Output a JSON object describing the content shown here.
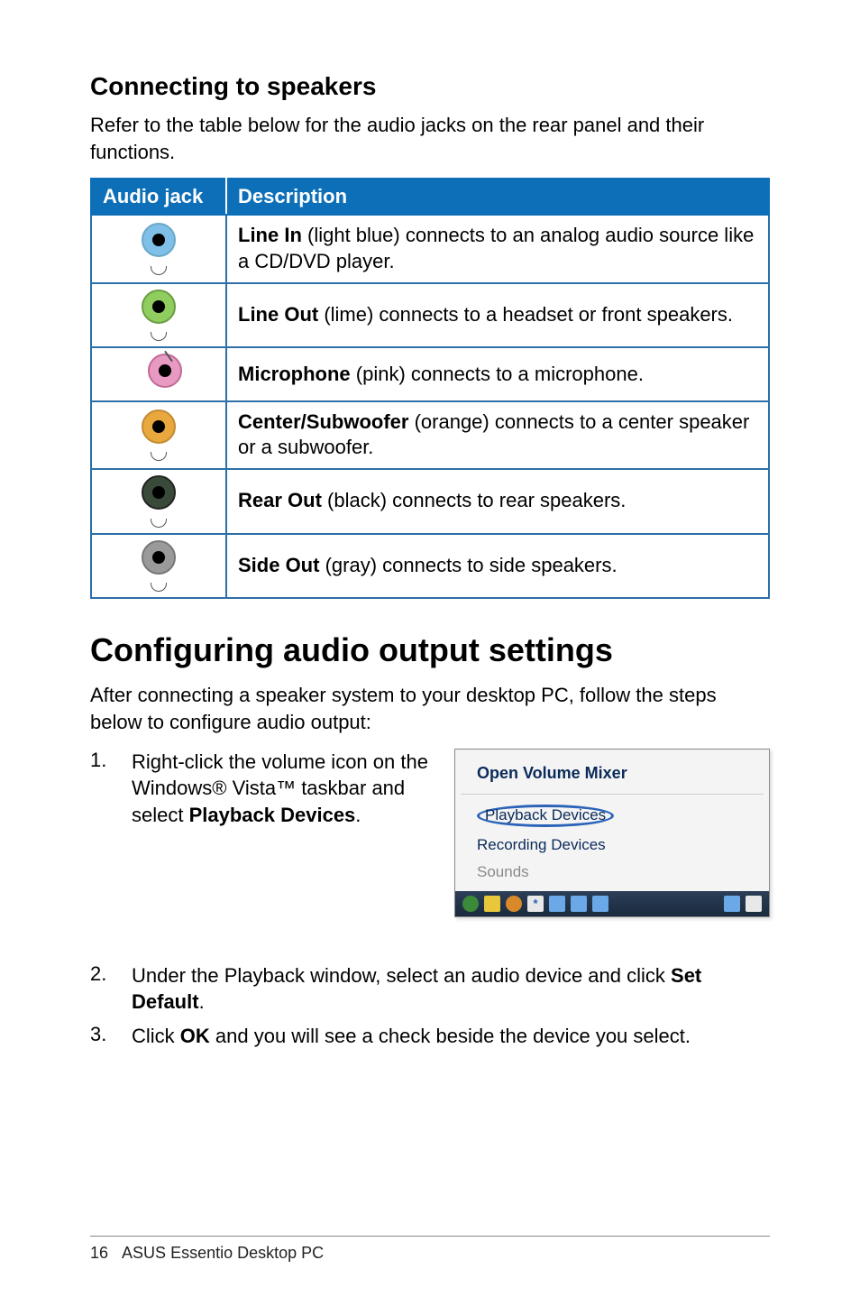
{
  "section1": {
    "heading": "Connecting to speakers",
    "intro": "Refer to the table below for the audio jacks on the rear panel and their functions."
  },
  "table": {
    "header_jack": "Audio jack",
    "header_desc": "Description",
    "rows": [
      {
        "bold": "Line In",
        "rest": " (light blue) connects to an analog audio source like a CD/DVD player."
      },
      {
        "bold": "Line Out",
        "rest": " (lime) connects to a headset or front speakers."
      },
      {
        "bold": "Microphone",
        "rest": " (pink) connects to a microphone."
      },
      {
        "bold": "Center/Subwoofer",
        "rest": " (orange) connects to a center speaker or a subwoofer."
      },
      {
        "bold": "Rear Out",
        "rest": " (black) connects to rear speakers."
      },
      {
        "bold": "Side Out",
        "rest": " (gray) connects to side speakers."
      }
    ]
  },
  "section2": {
    "heading": "Configuring audio output settings",
    "intro": "After connecting a speaker system to your desktop PC, follow the steps below to configure audio output:"
  },
  "steps": {
    "s1_num": "1.",
    "s1_pre": "Right-click the volume icon on the Windows® Vista™ taskbar and select ",
    "s1_bold": "Playback Devices",
    "s1_post": ".",
    "s2_num": "2.",
    "s2_pre": "Under the Playback window, select an audio device and click ",
    "s2_bold": "Set Default",
    "s2_post": ".",
    "s3_num": "3.",
    "s3_pre": "Click ",
    "s3_bold": "OK",
    "s3_post": " and you will see a check beside the device you select."
  },
  "menu": {
    "title": "Open Volume Mixer",
    "item1": "Playback Devices",
    "item2": "Recording Devices",
    "item3": "Sounds",
    "bt_icon": "*"
  },
  "footer": {
    "page": "16",
    "text": "ASUS Essentio Desktop PC"
  }
}
